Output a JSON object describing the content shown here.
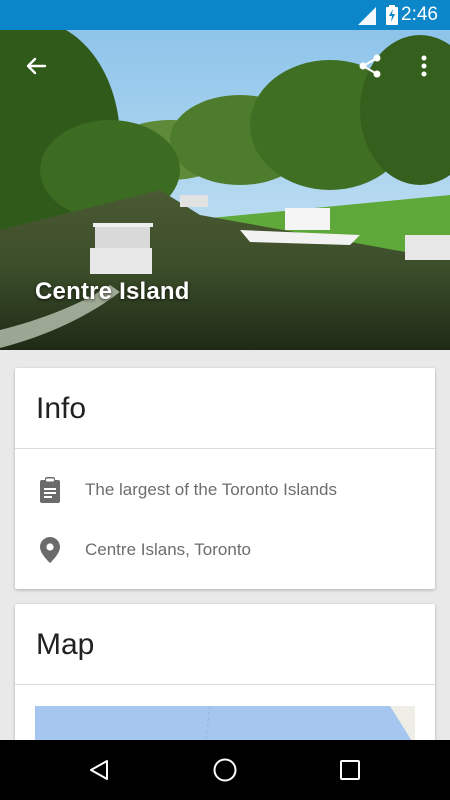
{
  "status_bar": {
    "time": "2:46",
    "icons": [
      "signal-icon",
      "battery-charging-icon"
    ],
    "color": "#0a86c9"
  },
  "hero": {
    "title": "Centre Island",
    "actions": [
      "back-arrow-icon",
      "share-icon",
      "more-vert-icon"
    ]
  },
  "info_card": {
    "title": "Info",
    "rows": [
      {
        "icon": "clipboard-icon",
        "text": "The largest of the Toronto Islands"
      },
      {
        "icon": "location-pin-icon",
        "text": "Centre Islans, Toronto"
      }
    ]
  },
  "map_card": {
    "title": "Map"
  },
  "nav_bar": {
    "buttons": [
      "nav-back-icon",
      "nav-home-icon",
      "nav-recents-icon"
    ]
  }
}
